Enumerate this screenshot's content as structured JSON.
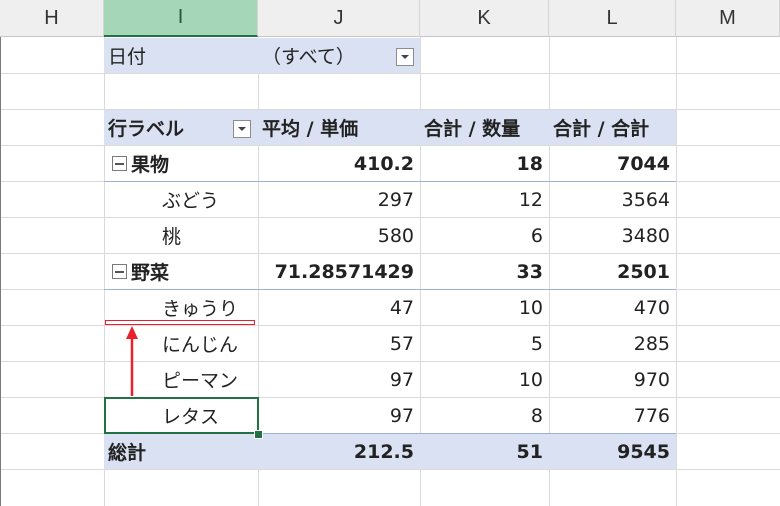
{
  "columns": [
    "H",
    "I",
    "J",
    "K",
    "L",
    "M"
  ],
  "filter": {
    "label": "日付",
    "value": "（すべて）"
  },
  "pivot": {
    "headers": [
      "行ラベル",
      "平均 / 単価",
      "合計 / 数量",
      "合計 / 合計"
    ],
    "rows": [
      {
        "label": "果物",
        "avg": "410.2",
        "qty": "18",
        "total": "7044",
        "type": "group"
      },
      {
        "label": "ぶどう",
        "avg": "297",
        "qty": "12",
        "total": "3564",
        "type": "item"
      },
      {
        "label": "桃",
        "avg": "580",
        "qty": "6",
        "total": "3480",
        "type": "item"
      },
      {
        "label": "野菜",
        "avg": "71.28571429",
        "qty": "33",
        "total": "2501",
        "type": "group"
      },
      {
        "label": "きゅうり",
        "avg": "47",
        "qty": "10",
        "total": "470",
        "type": "item"
      },
      {
        "label": "にんじん",
        "avg": "57",
        "qty": "5",
        "total": "285",
        "type": "item"
      },
      {
        "label": "ピーマン",
        "avg": "97",
        "qty": "10",
        "total": "970",
        "type": "item"
      },
      {
        "label": "レタス",
        "avg": "97",
        "qty": "8",
        "total": "776",
        "type": "item"
      }
    ],
    "grand_total": {
      "label": "総計",
      "avg": "212.5",
      "qty": "51",
      "total": "9545"
    }
  },
  "colors": {
    "header_band": "#d9e1f2",
    "selection": "#217346",
    "annotation": "#e8212b"
  },
  "icons": {
    "expander": "minus",
    "dropdown": "chevron-down",
    "annotation": "up-arrow"
  }
}
